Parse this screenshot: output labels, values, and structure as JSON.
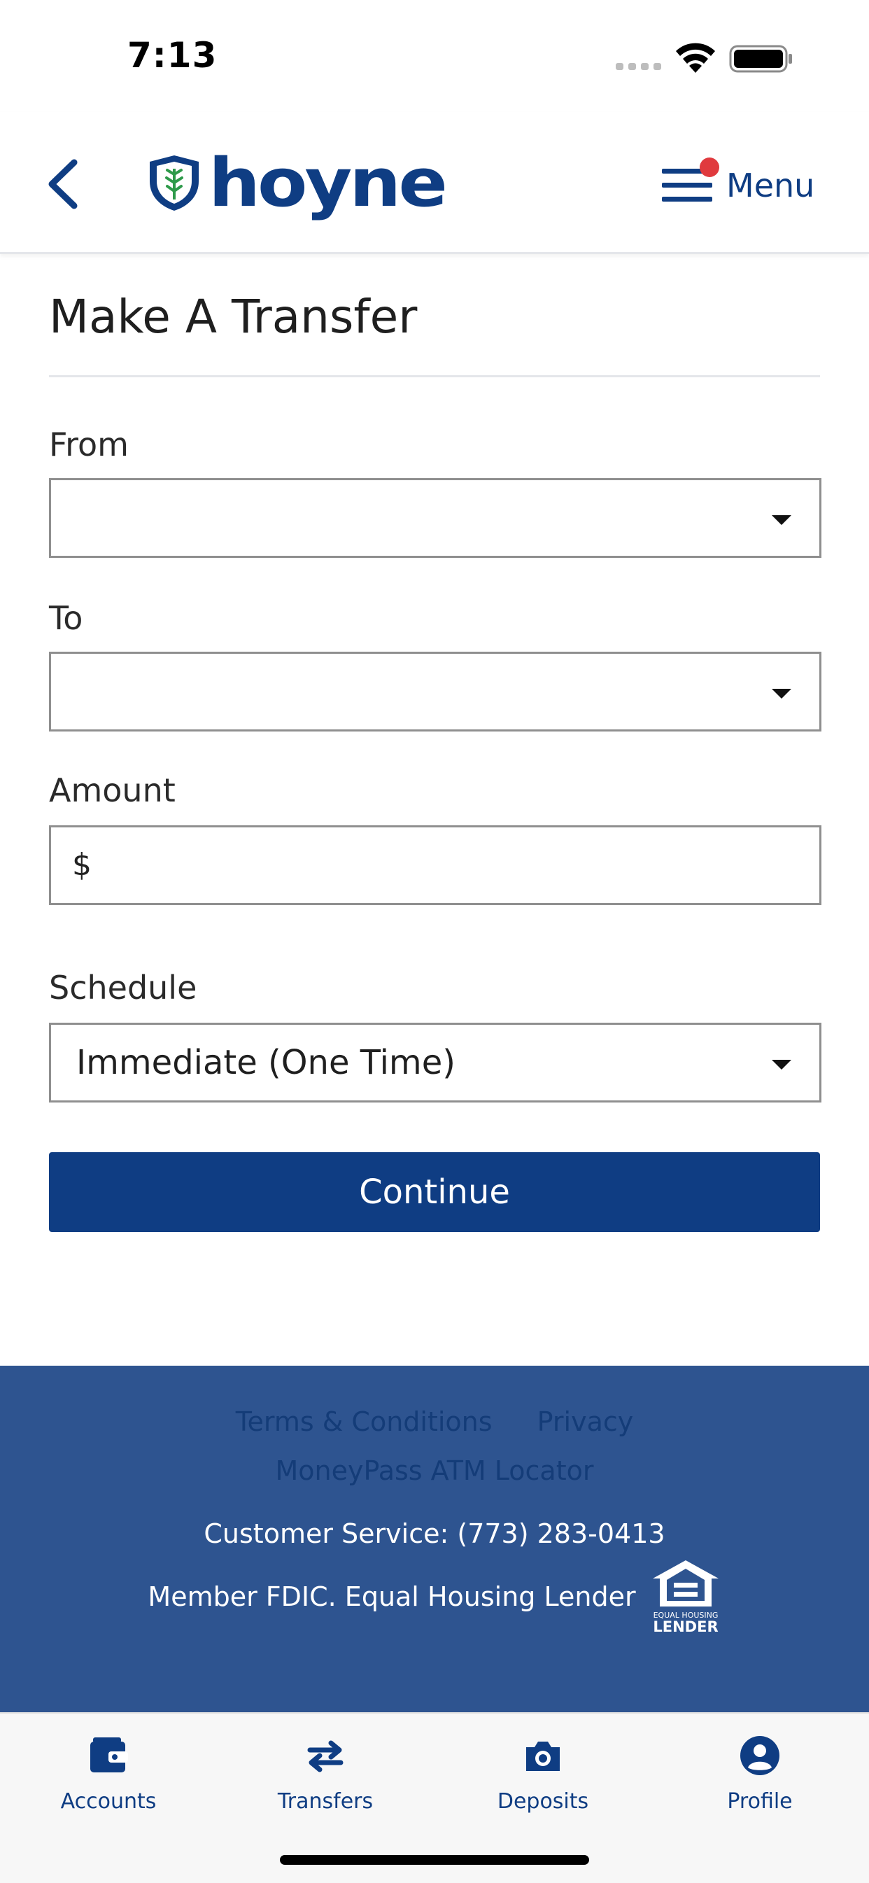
{
  "status_bar": {
    "time": "7:13"
  },
  "header": {
    "brand": "hoyne",
    "menu_label": "Menu",
    "icons": {
      "back": "chevron-left-icon",
      "menu": "hamburger-icon",
      "notification": "notification-dot"
    }
  },
  "page": {
    "title": "Make A Transfer"
  },
  "form": {
    "from": {
      "label": "From",
      "value": ""
    },
    "to": {
      "label": "To",
      "value": ""
    },
    "amount": {
      "label": "Amount",
      "currency_symbol": "$",
      "value": ""
    },
    "schedule": {
      "label": "Schedule",
      "value": "Immediate (One Time)"
    },
    "continue_label": "Continue"
  },
  "footer": {
    "links": [
      "Terms & Conditions",
      "Privacy",
      "MoneyPass ATM Locator"
    ],
    "customer_service": "Customer Service: (773) 283-0413",
    "fdic": "Member FDIC. Equal Housing Lender",
    "eho_small": "EQUAL HOUSING",
    "eho_large": "LENDER"
  },
  "tabs": [
    {
      "label": "Accounts",
      "icon": "wallet-icon"
    },
    {
      "label": "Transfers",
      "icon": "transfer-arrows-icon"
    },
    {
      "label": "Deposits",
      "icon": "camera-icon"
    },
    {
      "label": "Profile",
      "icon": "person-circle-icon"
    }
  ],
  "colors": {
    "brand_blue": "#0f3d83",
    "footer_blue": "#2e5490",
    "notification_red": "#e03a3e"
  }
}
